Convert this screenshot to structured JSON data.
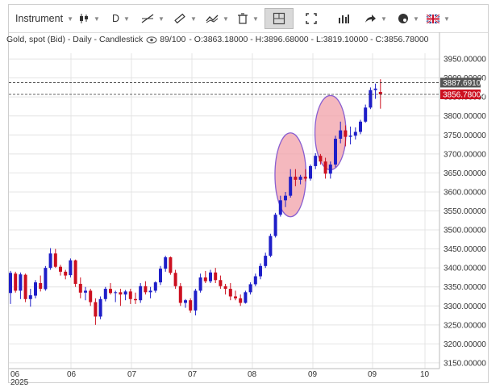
{
  "toolbar": {
    "instrument_label": "Instrument",
    "period_label": "D",
    "colors": {
      "accent": "#ddeeff"
    }
  },
  "info": {
    "title": "Gold, spot (Bid) - Daily - Candlestick",
    "visibility": "89/100",
    "ohlc": "- O:3863.18000 - H:3896.68000 - L:3819.10000 - C:3856.78000"
  },
  "price_axis": {
    "ticks": [
      "3950.00000",
      "3900.00000",
      "3850.00000",
      "3800.00000",
      "3750.00000",
      "3700.00000",
      "3650.00000",
      "3600.00000",
      "3550.00000",
      "3500.00000",
      "3450.00000",
      "3400.00000",
      "3350.00000",
      "3300.00000",
      "3250.00000",
      "3200.00000",
      "3150.00000"
    ],
    "cursor_label": "3887.69106",
    "last_label": "3856.78000"
  },
  "chart_data": {
    "type": "candlestick",
    "title": "Gold, spot (Bid) - Daily - Candlestick",
    "y_ticks": [
      3950,
      3900,
      3850,
      3800,
      3750,
      3700,
      3650,
      3600,
      3550,
      3500,
      3450,
      3400,
      3350,
      3300,
      3250,
      3200,
      3150
    ],
    "y_range": [
      3135,
      3965
    ],
    "x_tick_labels": [
      "06",
      "06",
      "07",
      "07",
      "08",
      "09",
      "09",
      "10"
    ],
    "x_year_label": "2025",
    "grid": true,
    "reference_lines": {
      "cursor": 3887.69106,
      "last": 3856.78
    },
    "colors": {
      "up": "#1e1ec8",
      "down": "#cc1020",
      "grid": "#e4e4e4",
      "last_label_bg": "#cc1020",
      "cursor_label_bg": "#555555",
      "highlight_fill": "#f2a0a8",
      "highlight_stroke": "#8a5fd0"
    },
    "highlights": [
      {
        "candle_index": 56,
        "price": 3645,
        "rx": 3.1,
        "ry": 52
      },
      {
        "candle_index": 64,
        "price": 3756,
        "rx": 3.1,
        "ry": 46
      }
    ],
    "candles": [
      {
        "o": 3334,
        "h": 3392,
        "l": 3305,
        "c": 3387
      },
      {
        "o": 3385,
        "h": 3390,
        "l": 3335,
        "c": 3340
      },
      {
        "o": 3340,
        "h": 3388,
        "l": 3318,
        "c": 3383
      },
      {
        "o": 3382,
        "h": 3385,
        "l": 3310,
        "c": 3318
      },
      {
        "o": 3318,
        "h": 3345,
        "l": 3298,
        "c": 3328
      },
      {
        "o": 3327,
        "h": 3368,
        "l": 3320,
        "c": 3362
      },
      {
        "o": 3360,
        "h": 3380,
        "l": 3338,
        "c": 3345
      },
      {
        "o": 3344,
        "h": 3405,
        "l": 3340,
        "c": 3400
      },
      {
        "o": 3400,
        "h": 3452,
        "l": 3395,
        "c": 3438
      },
      {
        "o": 3438,
        "h": 3450,
        "l": 3400,
        "c": 3403
      },
      {
        "o": 3403,
        "h": 3408,
        "l": 3380,
        "c": 3390
      },
      {
        "o": 3390,
        "h": 3395,
        "l": 3370,
        "c": 3380
      },
      {
        "o": 3381,
        "h": 3425,
        "l": 3375,
        "c": 3420
      },
      {
        "o": 3420,
        "h": 3422,
        "l": 3350,
        "c": 3358
      },
      {
        "o": 3358,
        "h": 3375,
        "l": 3320,
        "c": 3335
      },
      {
        "o": 3335,
        "h": 3350,
        "l": 3315,
        "c": 3340
      },
      {
        "o": 3340,
        "h": 3345,
        "l": 3300,
        "c": 3310
      },
      {
        "o": 3310,
        "h": 3320,
        "l": 3250,
        "c": 3272
      },
      {
        "o": 3272,
        "h": 3325,
        "l": 3265,
        "c": 3318
      },
      {
        "o": 3318,
        "h": 3350,
        "l": 3312,
        "c": 3345
      },
      {
        "o": 3345,
        "h": 3360,
        "l": 3330,
        "c": 3334
      },
      {
        "o": 3334,
        "h": 3340,
        "l": 3310,
        "c": 3336
      },
      {
        "o": 3336,
        "h": 3345,
        "l": 3300,
        "c": 3330
      },
      {
        "o": 3330,
        "h": 3342,
        "l": 3315,
        "c": 3338
      },
      {
        "o": 3338,
        "h": 3345,
        "l": 3305,
        "c": 3318
      },
      {
        "o": 3318,
        "h": 3335,
        "l": 3305,
        "c": 3315
      },
      {
        "o": 3315,
        "h": 3360,
        "l": 3308,
        "c": 3352
      },
      {
        "o": 3352,
        "h": 3365,
        "l": 3330,
        "c": 3336
      },
      {
        "o": 3336,
        "h": 3350,
        "l": 3320,
        "c": 3340
      },
      {
        "o": 3340,
        "h": 3365,
        "l": 3335,
        "c": 3362
      },
      {
        "o": 3362,
        "h": 3405,
        "l": 3355,
        "c": 3398
      },
      {
        "o": 3398,
        "h": 3432,
        "l": 3390,
        "c": 3428
      },
      {
        "o": 3428,
        "h": 3430,
        "l": 3382,
        "c": 3387
      },
      {
        "o": 3387,
        "h": 3395,
        "l": 3345,
        "c": 3352
      },
      {
        "o": 3352,
        "h": 3360,
        "l": 3300,
        "c": 3308
      },
      {
        "o": 3308,
        "h": 3318,
        "l": 3295,
        "c": 3315
      },
      {
        "o": 3315,
        "h": 3320,
        "l": 3282,
        "c": 3288
      },
      {
        "o": 3288,
        "h": 3345,
        "l": 3275,
        "c": 3340
      },
      {
        "o": 3340,
        "h": 3385,
        "l": 3335,
        "c": 3375
      },
      {
        "o": 3375,
        "h": 3392,
        "l": 3360,
        "c": 3365
      },
      {
        "o": 3365,
        "h": 3395,
        "l": 3360,
        "c": 3388
      },
      {
        "o": 3388,
        "h": 3400,
        "l": 3360,
        "c": 3368
      },
      {
        "o": 3368,
        "h": 3380,
        "l": 3345,
        "c": 3352
      },
      {
        "o": 3352,
        "h": 3358,
        "l": 3330,
        "c": 3345
      },
      {
        "o": 3345,
        "h": 3360,
        "l": 3315,
        "c": 3325
      },
      {
        "o": 3325,
        "h": 3340,
        "l": 3315,
        "c": 3320
      },
      {
        "o": 3320,
        "h": 3330,
        "l": 3300,
        "c": 3308
      },
      {
        "o": 3308,
        "h": 3340,
        "l": 3306,
        "c": 3336
      },
      {
        "o": 3336,
        "h": 3362,
        "l": 3330,
        "c": 3357
      },
      {
        "o": 3357,
        "h": 3385,
        "l": 3352,
        "c": 3378
      },
      {
        "o": 3378,
        "h": 3412,
        "l": 3370,
        "c": 3405
      },
      {
        "o": 3405,
        "h": 3440,
        "l": 3400,
        "c": 3432
      },
      {
        "o": 3432,
        "h": 3490,
        "l": 3428,
        "c": 3484
      },
      {
        "o": 3484,
        "h": 3545,
        "l": 3480,
        "c": 3540
      },
      {
        "o": 3540,
        "h": 3590,
        "l": 3535,
        "c": 3578
      },
      {
        "o": 3578,
        "h": 3600,
        "l": 3560,
        "c": 3590
      },
      {
        "o": 3590,
        "h": 3660,
        "l": 3585,
        "c": 3640
      },
      {
        "o": 3640,
        "h": 3660,
        "l": 3615,
        "c": 3632
      },
      {
        "o": 3632,
        "h": 3645,
        "l": 3620,
        "c": 3640
      },
      {
        "o": 3640,
        "h": 3660,
        "l": 3628,
        "c": 3635
      },
      {
        "o": 3635,
        "h": 3672,
        "l": 3630,
        "c": 3668
      },
      {
        "o": 3668,
        "h": 3702,
        "l": 3660,
        "c": 3695
      },
      {
        "o": 3695,
        "h": 3700,
        "l": 3672,
        "c": 3680
      },
      {
        "o": 3680,
        "h": 3690,
        "l": 3635,
        "c": 3648
      },
      {
        "o": 3648,
        "h": 3680,
        "l": 3635,
        "c": 3672
      },
      {
        "o": 3672,
        "h": 3748,
        "l": 3665,
        "c": 3740
      },
      {
        "o": 3740,
        "h": 3785,
        "l": 3728,
        "c": 3762
      },
      {
        "o": 3762,
        "h": 3775,
        "l": 3720,
        "c": 3745
      },
      {
        "o": 3745,
        "h": 3772,
        "l": 3725,
        "c": 3748
      },
      {
        "o": 3748,
        "h": 3770,
        "l": 3738,
        "c": 3758
      },
      {
        "o": 3758,
        "h": 3790,
        "l": 3752,
        "c": 3785
      },
      {
        "o": 3785,
        "h": 3830,
        "l": 3782,
        "c": 3822
      },
      {
        "o": 3822,
        "h": 3875,
        "l": 3818,
        "c": 3868
      },
      {
        "o": 3868,
        "h": 3885,
        "l": 3845,
        "c": 3872
      },
      {
        "o": 3863.18,
        "h": 3896.68,
        "l": 3819.1,
        "c": 3856.78
      }
    ]
  }
}
